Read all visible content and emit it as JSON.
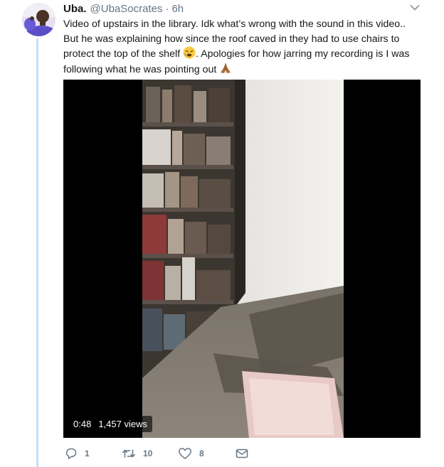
{
  "tweet": {
    "display_name": "Uba.",
    "handle": "@UbaSocrates",
    "separator": "·",
    "time": "6h",
    "text_lines": [
      "Video of upstairs in the library. Idk what’s wrong with the sound in this video..",
      "But he was explaining how since the roof caved in they had to use chairs to",
      "protect the top of the shelf",
      ". Apologies for how jarring my recording is I was",
      "following what he was pointing out"
    ],
    "emoji_1": "tired-face-emoji",
    "emoji_2": "folded-hands-emoji"
  },
  "video": {
    "duration": "0:48",
    "views": "1,457 views"
  },
  "actions": {
    "reply_count": "1",
    "retweet_count": "10",
    "like_count": "8"
  },
  "icons": {
    "reply": "reply-icon",
    "retweet": "retweet-icon",
    "like": "heart-icon",
    "dm": "envelope-icon",
    "menu": "chevron-down-icon"
  },
  "colors": {
    "thread_line": "#c4e0f4",
    "secondary_text": "#657786",
    "primary_text": "#14171a"
  }
}
